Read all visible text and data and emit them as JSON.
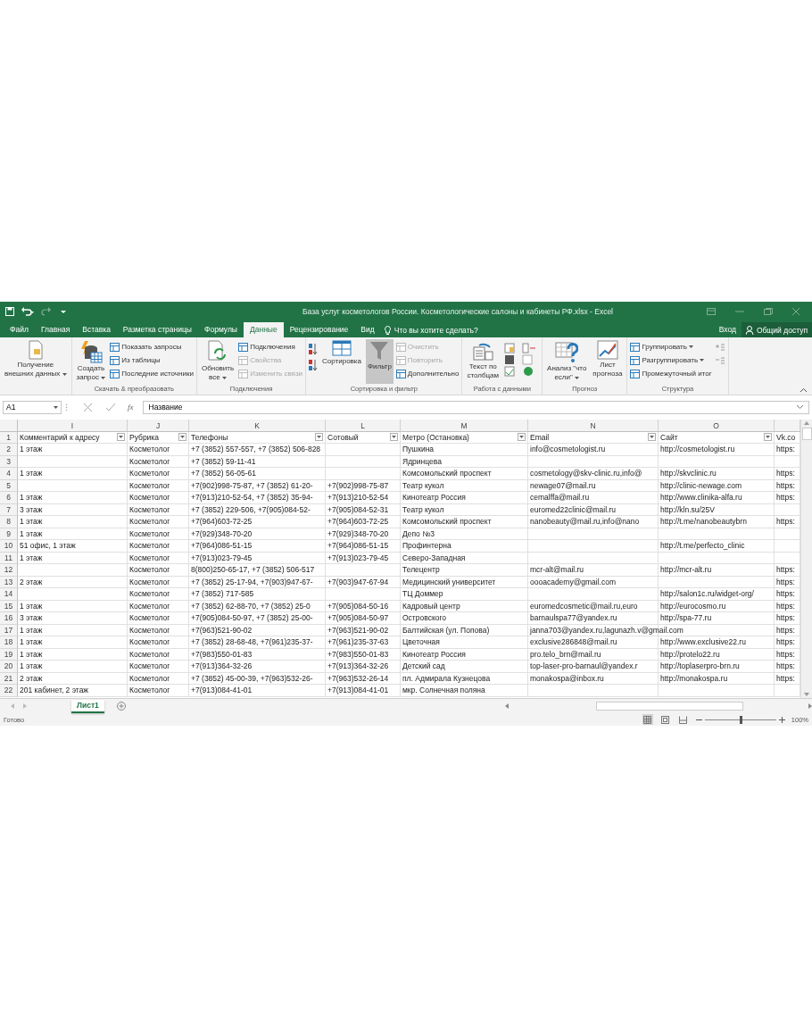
{
  "window": {
    "title": "База услуг косметологов России. Косметологические салоны и кабинеты РФ.xlsx - Excel"
  },
  "tabs": [
    {
      "label": "Файл",
      "selected": false
    },
    {
      "label": "Главная",
      "selected": false
    },
    {
      "label": "Вставка",
      "selected": false
    },
    {
      "label": "Разметка страницы",
      "selected": false
    },
    {
      "label": "Формулы",
      "selected": false
    },
    {
      "label": "Данные",
      "selected": true
    },
    {
      "label": "Рецензирование",
      "selected": false
    },
    {
      "label": "Вид",
      "selected": false
    }
  ],
  "tell_me": {
    "placeholder": "Что вы хотите сделать?"
  },
  "account": {
    "sign_in": "Вход",
    "share": "Общий доступ"
  },
  "ribbon": {
    "groups": [
      {
        "items": [
          {
            "kind": "large",
            "label": "Получение\nвнешних данных",
            "dropdown": true,
            "selected": false
          }
        ]
      },
      {
        "label": "Скачать & преобразовать",
        "items": [
          {
            "kind": "large",
            "label": "Создать\nзапрос",
            "dropdown": true,
            "selected": false
          },
          {
            "kind": "stack",
            "items": [
              {
                "label": "Показать запросы",
                "disabled": false
              },
              {
                "label": "Из таблицы",
                "disabled": false
              },
              {
                "label": "Последние источники",
                "disabled": false
              }
            ]
          }
        ]
      },
      {
        "label": "Подключения",
        "items": [
          {
            "kind": "large",
            "label": "Обновить\nвсе",
            "dropdown": true,
            "selected": false
          },
          {
            "kind": "stack",
            "items": [
              {
                "label": "Подключения",
                "disabled": false
              },
              {
                "label": "Свойства",
                "disabled": true
              },
              {
                "label": "Изменить связи",
                "disabled": true
              }
            ]
          }
        ]
      },
      {
        "label": "Сортировка и фильтр",
        "items": [
          {
            "kind": "sort"
          },
          {
            "kind": "large",
            "label": "Сортировка",
            "dropdown": false,
            "selected": false
          },
          {
            "kind": "large",
            "label": "Фильтр",
            "dropdown": false,
            "selected": true
          },
          {
            "kind": "stack",
            "items": [
              {
                "label": "Очистить",
                "disabled": true
              },
              {
                "label": "Повторить",
                "disabled": true
              },
              {
                "label": "Дополнительно",
                "disabled": false
              }
            ]
          }
        ]
      },
      {
        "label": "Работа с данными",
        "items": [
          {
            "kind": "large",
            "label": "Текст по\nстолбцам",
            "dropdown": false,
            "selected": false
          },
          {
            "kind": "datatools"
          }
        ]
      },
      {
        "label": "Прогноз",
        "items": [
          {
            "kind": "large",
            "label": "Анализ \"что\nесли\"",
            "dropdown": true,
            "selected": false
          },
          {
            "kind": "large",
            "label": "Лист\nпрогноза",
            "dropdown": false,
            "selected": false
          }
        ]
      },
      {
        "label": "Структура",
        "items": [
          {
            "kind": "stack",
            "items": [
              {
                "label": "Группировать",
                "disabled": false,
                "dropdown": true
              },
              {
                "label": "Разгруппировать",
                "disabled": false,
                "dropdown": true
              },
              {
                "label": "Промежуточный итог",
                "disabled": false,
                "dropdown": false
              }
            ]
          },
          {
            "kind": "outline"
          }
        ]
      }
    ]
  },
  "formula_bar": {
    "name_box": "A1",
    "fx": "fx",
    "value": "Название"
  },
  "sheet": {
    "columns": [
      {
        "letter": "I",
        "header": "Комментарий к адресу",
        "filter": true
      },
      {
        "letter": "J",
        "header": "Рубрика",
        "filter": true
      },
      {
        "letter": "K",
        "header": "Телефоны",
        "filter": true
      },
      {
        "letter": "L",
        "header": "Сотовый",
        "filter": true
      },
      {
        "letter": "M",
        "header": "Метро (Остановка)",
        "filter": true
      },
      {
        "letter": "N",
        "header": "Email",
        "filter": true
      },
      {
        "letter": "O",
        "header": "Сайт",
        "filter": true
      },
      {
        "header": "Vk.co",
        "filter": false
      }
    ],
    "header_row": "1",
    "rows": [
      {
        "row": "2",
        "cells": [
          "1 этаж",
          "Косметолог",
          "+7 (3852) 557-557, +7 (3852) 506-828",
          null,
          "Пушкина",
          "info@cosmetologist.ru",
          "http://cosmetologist.ru",
          "https:"
        ]
      },
      {
        "row": "3",
        "cells": [
          null,
          "Косметолог",
          "+7 (3852) 59-11-41",
          null,
          "Ядринцева",
          null,
          null,
          null
        ]
      },
      {
        "row": "4",
        "cells": [
          "1 этаж",
          "Косметолог",
          "+7 (3852) 56-05-61",
          null,
          "Комсомольский проспект",
          "cosmetology@skv-clinic.ru,info@",
          "http://skvclinic.ru",
          "https:"
        ]
      },
      {
        "row": "5",
        "cells": [
          null,
          "Косметолог",
          "+7(902)998-75-87, +7 (3852) 61-20-",
          "+7(902)998-75-87",
          "Театр кукол",
          "newage07@mail.ru",
          "http://clinic-newage.com",
          "https:"
        ]
      },
      {
        "row": "6",
        "cells": [
          "1 этаж",
          "Косметолог",
          "+7(913)210-52-54, +7 (3852) 35-94-",
          "+7(913)210-52-54",
          "Кинотеатр Россия",
          "cemalffa@mail.ru",
          "http://www.clinika-alfa.ru",
          "https:"
        ]
      },
      {
        "row": "7",
        "cells": [
          "3 этаж",
          "Косметолог",
          "+7 (3852) 229-506, +7(905)084-52-",
          "+7(905)084-52-31",
          "Театр кукол",
          "euromed22clinic@mail.ru",
          "http://kln.su/25V",
          null
        ]
      },
      {
        "row": "8",
        "cells": [
          "1 этаж",
          "Косметолог",
          "+7(964)603-72-25",
          "+7(964)603-72-25",
          "Комсомольский проспект",
          "nanobeauty@mail.ru,info@nano",
          "http://t.me/nanobeautybrn",
          "https:"
        ]
      },
      {
        "row": "9",
        "cells": [
          "1 этаж",
          "Косметолог",
          "+7(929)348-70-20",
          "+7(929)348-70-20",
          "Депо №3",
          null,
          null,
          null
        ]
      },
      {
        "row": "10",
        "cells": [
          "51 офис, 1 этаж",
          "Косметолог",
          "+7(964)086-51-15",
          "+7(964)086-51-15",
          "Профинтерна",
          null,
          "http://t.me/perfecto_clinic",
          null
        ]
      },
      {
        "row": "11",
        "cells": [
          "1 этаж",
          "Косметолог",
          "+7(913)023-79-45",
          "+7(913)023-79-45",
          "Северо-Западная",
          null,
          null,
          null
        ]
      },
      {
        "row": "12",
        "cells": [
          null,
          "Косметолог",
          "8(800)250-65-17, +7 (3852) 506-517",
          null,
          "Телецентр",
          "mcr-alt@mail.ru",
          "http://mcr-alt.ru",
          "https:"
        ]
      },
      {
        "row": "13",
        "cells": [
          "2 этаж",
          "Косметолог",
          "+7 (3852) 25-17-94, +7(903)947-67-",
          "+7(903)947-67-94",
          "Медицинский университет",
          "oooacademy@gmail.com",
          null,
          "https:"
        ]
      },
      {
        "row": "14",
        "cells": [
          null,
          "Косметолог",
          "+7 (3852) 717-585",
          null,
          "ТЦ Доммер",
          null,
          "http://salon1c.ru/widget-org/",
          "https:"
        ]
      },
      {
        "row": "15",
        "cells": [
          "1 этаж",
          "Косметолог",
          "+7 (3852) 62-88-70, +7 (3852) 25-0",
          "+7(905)084-50-16",
          "Кадровый центр",
          "euromedcosmetic@mail.ru,euro",
          "http://eurocosmo.ru",
          "https:"
        ]
      },
      {
        "row": "16",
        "cells": [
          "3 этаж",
          "Косметолог",
          "+7(905)084-50-97, +7 (3852) 25-00-",
          "+7(905)084-50-97",
          "Островского",
          "barnaulspa77@yandex.ru",
          "http://spa-77.ru",
          "https:"
        ]
      },
      {
        "row": "17",
        "cells": [
          "1 этаж",
          "Косметолог",
          "+7(963)521-90-02",
          "+7(963)521-90-02",
          "Балтийская (ул. Попова)",
          "janna703@yandex.ru,lagunazh.v@gmail.com",
          null,
          "https:"
        ]
      },
      {
        "row": "18",
        "cells": [
          "1 этаж",
          "Косметолог",
          "+7 (3852) 28-68-48, +7(961)235-37-",
          "+7(961)235-37-63",
          "Цветочная",
          "exclusive286848@mail.ru",
          "http://www.exclusive22.ru",
          "https:"
        ]
      },
      {
        "row": "19",
        "cells": [
          "1 этаж",
          "Косметолог",
          "+7(983)550-01-83",
          "+7(983)550-01-83",
          "Кинотеатр Россия",
          "pro.telo_brn@mail.ru",
          "http://protelo22.ru",
          "https:"
        ]
      },
      {
        "row": "20",
        "cells": [
          "1 этаж",
          "Косметолог",
          "+7(913)364-32-26",
          "+7(913)364-32-26",
          "Детский сад",
          "top-laser-pro-barnaul@yandex.r",
          "http://toplaserpro-brn.ru",
          "https:"
        ]
      },
      {
        "row": "21",
        "cells": [
          "2 этаж",
          "Косметолог",
          "+7 (3852) 45-00-39, +7(963)532-26-",
          "+7(963)532-26-14",
          "пл. Адмирала Кузнецова",
          "monakospa@inbox.ru",
          "http://monakospa.ru",
          "https:"
        ]
      },
      {
        "row": "22",
        "cells": [
          "201 кабинет, 2 этаж",
          "Косметолог",
          "+7(913)084-41-01",
          "+7(913)084-41-01",
          "мкр. Солнечная поляна",
          null,
          null,
          null
        ]
      }
    ]
  },
  "sheet_tabs": [
    {
      "label": "Лист1",
      "selected": true
    }
  ],
  "status_bar": {
    "status": "Готово",
    "zoom": {
      "level": 0.5,
      "reading": "100%"
    }
  }
}
